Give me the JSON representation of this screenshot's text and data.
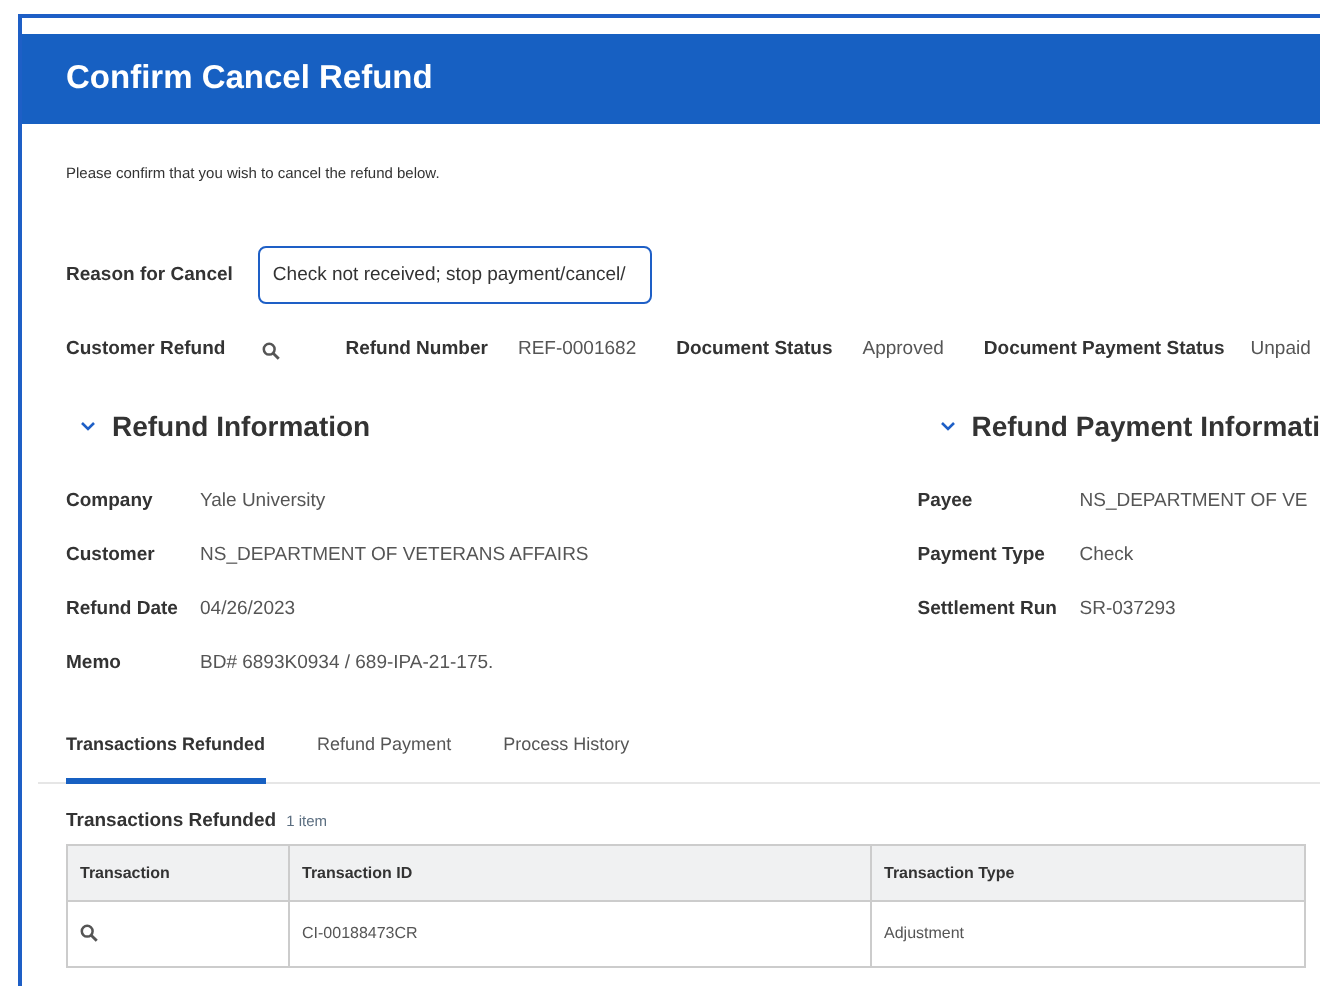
{
  "header": {
    "title": "Confirm Cancel Refund"
  },
  "intro": "Please confirm that you wish to cancel the refund below.",
  "reason": {
    "label": "Reason for Cancel",
    "value": "Check not received; stop payment/cancel/"
  },
  "summary": [
    {
      "label": "Customer Refund",
      "kind": "search"
    },
    {
      "label": "Refund Number",
      "value": "REF-0001682",
      "kind": "text"
    },
    {
      "label": "Document Status",
      "value": "Approved",
      "kind": "text"
    },
    {
      "label": "Document Payment Status",
      "value": "Unpaid",
      "kind": "text"
    }
  ],
  "sections": [
    {
      "title": "Refund Information",
      "expanded": true,
      "fields": [
        {
          "label": "Company",
          "value": "Yale University"
        },
        {
          "label": "Customer",
          "value": "NS_DEPARTMENT OF VETERANS AFFAIRS"
        },
        {
          "label": "Refund Date",
          "value": "04/26/2023"
        },
        {
          "label": "Memo",
          "value": "BD# 6893K0934 / 689-IPA-21-175."
        }
      ]
    },
    {
      "title": "Refund Payment Informati",
      "expanded": true,
      "fields": [
        {
          "label": "Payee",
          "value": "NS_DEPARTMENT OF VE"
        },
        {
          "label": "Payment Type",
          "value": "Check"
        },
        {
          "label": "Settlement Run",
          "value": "SR-037293"
        }
      ]
    }
  ],
  "tabs": [
    {
      "label": "Transactions Refunded",
      "selected": true
    },
    {
      "label": "Refund Payment",
      "selected": false
    },
    {
      "label": "Process History",
      "selected": false
    }
  ],
  "table": {
    "title": "Transactions Refunded",
    "count": "1 item",
    "columns": [
      "Transaction",
      "Transaction ID",
      "Transaction Type"
    ],
    "rows": [
      [
        {
          "kind": "search"
        },
        {
          "kind": "text",
          "text": "CI-00188473CR"
        },
        {
          "kind": "text",
          "text": "Adjustment"
        }
      ]
    ]
  }
}
